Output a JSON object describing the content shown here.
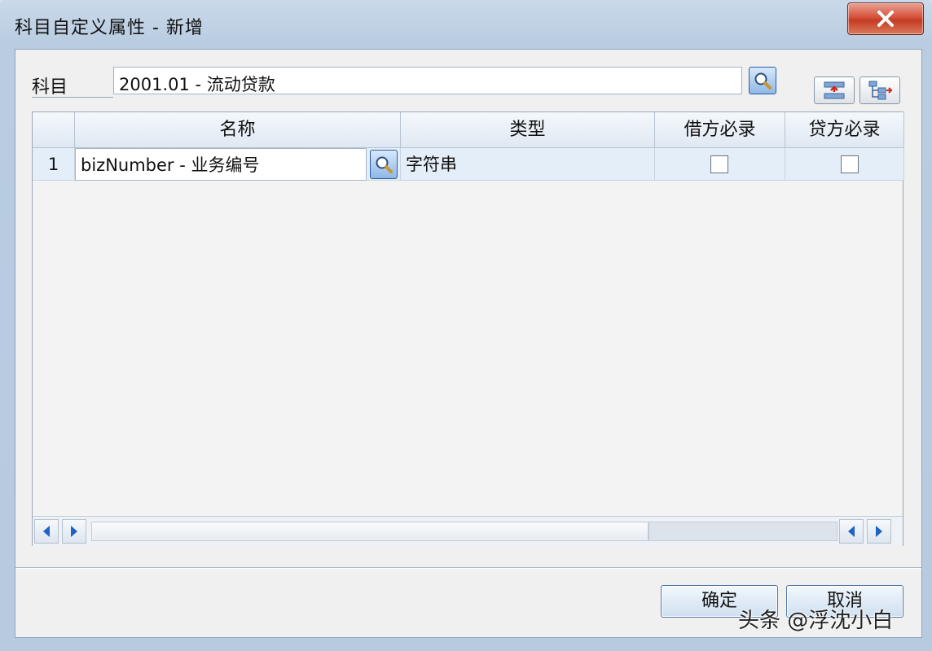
{
  "window": {
    "title": "科目自定义属性 - 新增"
  },
  "subject": {
    "label": "科目",
    "value": "2001.01 - 流动贷款"
  },
  "table": {
    "columns": [
      "名称",
      "类型",
      "借方必录",
      "贷方必录"
    ],
    "rows": [
      {
        "index": "1",
        "name": "bizNumber - 业务编号",
        "type": "字符串",
        "debit_required": false,
        "credit_required": false
      }
    ]
  },
  "buttons": {
    "ok": "确定",
    "cancel": "取消"
  },
  "watermark": "头条 @浮沈小白",
  "colors": {
    "title_bar": "#c9d9ea",
    "close_button": "#c33b23",
    "selected_row": "#e4eef8"
  }
}
